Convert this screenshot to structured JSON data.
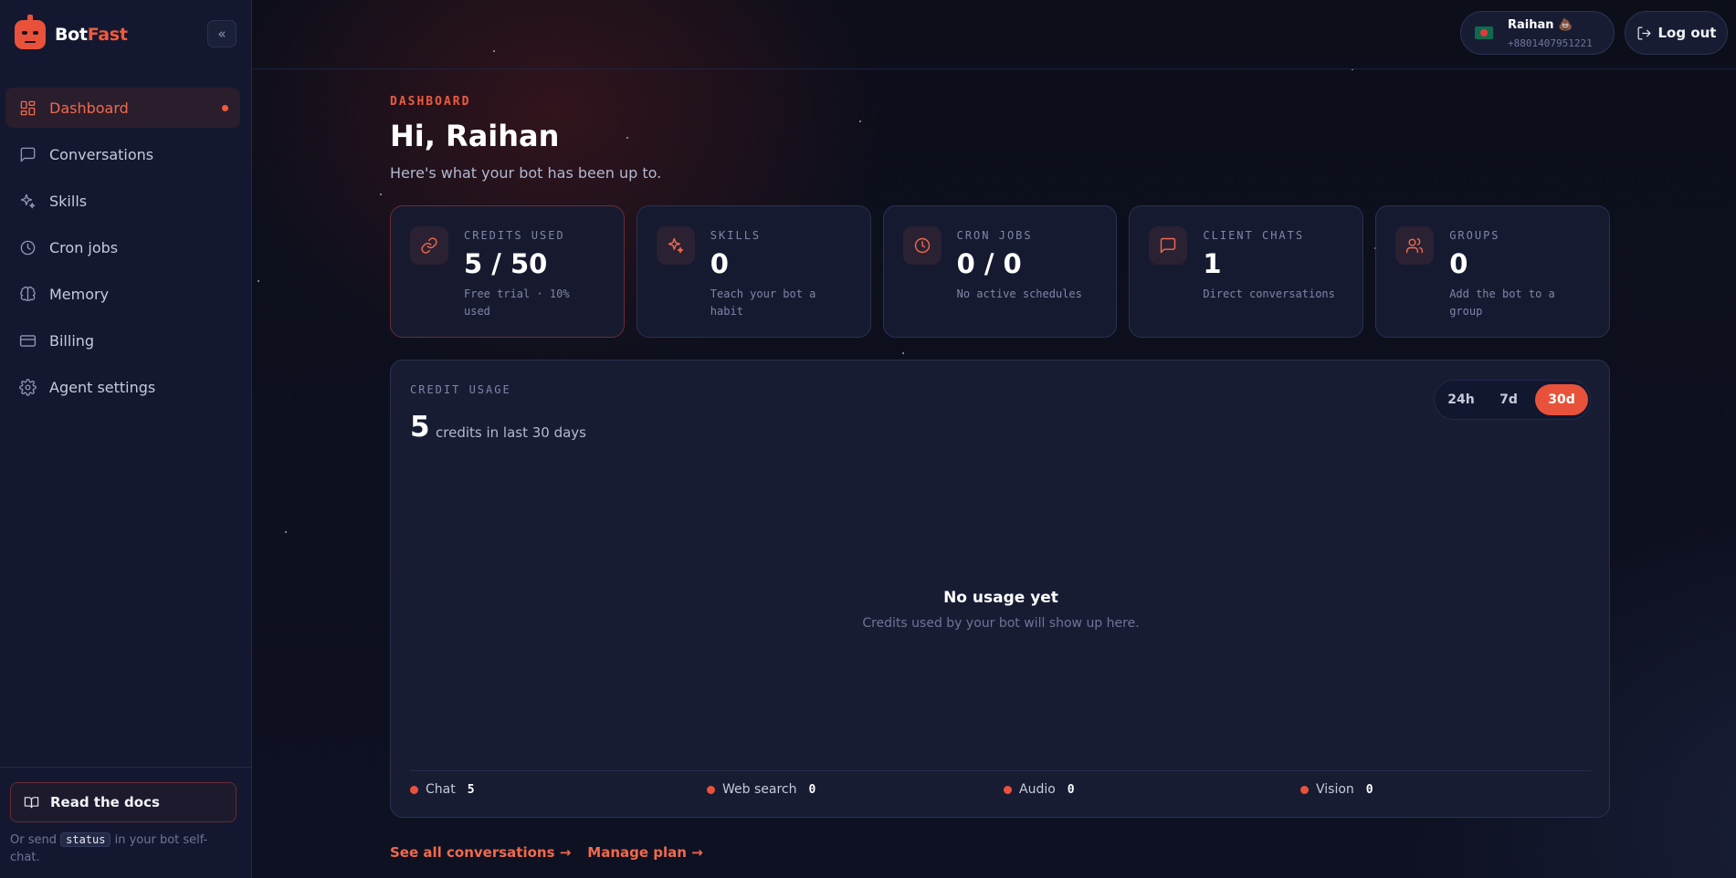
{
  "brand": {
    "name_a": "Bot",
    "name_b": "Fast"
  },
  "sidebar": {
    "items": [
      {
        "label": "Dashboard",
        "icon": "dashboard-icon"
      },
      {
        "label": "Conversations",
        "icon": "message-icon"
      },
      {
        "label": "Skills",
        "icon": "sparkle-icon"
      },
      {
        "label": "Cron jobs",
        "icon": "clock-icon"
      },
      {
        "label": "Memory",
        "icon": "brain-icon"
      },
      {
        "label": "Billing",
        "icon": "credit-card-icon"
      },
      {
        "label": "Agent settings",
        "icon": "gear-icon"
      }
    ],
    "docs_label": "Read the docs",
    "foot_pre": "Or send",
    "foot_code": "status",
    "foot_post": "in your bot self-chat."
  },
  "user": {
    "name": "Raihan 💩",
    "phone": "+8801407951221"
  },
  "logout_label": "Log out",
  "header": {
    "eyebrow": "DASHBOARD",
    "greeting": "Hi, Raihan",
    "subtitle": "Here's what your bot has been up to."
  },
  "stats": [
    {
      "label": "CREDITS USED",
      "value": "5 / 50",
      "desc": "Free trial · 10% used",
      "icon": "link-icon"
    },
    {
      "label": "SKILLS",
      "value": "0",
      "desc": "Teach your bot a habit",
      "icon": "sparkle-icon"
    },
    {
      "label": "CRON JOBS",
      "value": "0 / 0",
      "desc": "No active schedules",
      "icon": "clock-icon"
    },
    {
      "label": "CLIENT CHATS",
      "value": "1",
      "desc": "Direct conversations",
      "icon": "message-icon"
    },
    {
      "label": "GROUPS",
      "value": "0",
      "desc": "Add the bot to a group",
      "icon": "users-icon"
    }
  ],
  "usage": {
    "label": "CREDIT USAGE",
    "total": "5",
    "total_label": "credits in last 30 days",
    "ranges": [
      "24h",
      "7d",
      "30d"
    ],
    "selected_range": "30d",
    "empty_title": "No usage yet",
    "empty_sub": "Credits used by your bot will show up here.",
    "legend": [
      {
        "label": "Chat",
        "value": "5"
      },
      {
        "label": "Web search",
        "value": "0"
      },
      {
        "label": "Audio",
        "value": "0"
      },
      {
        "label": "Vision",
        "value": "0"
      }
    ]
  },
  "links": {
    "conversations": "See all conversations →",
    "plan": "Manage plan →"
  },
  "colors": {
    "accent": "#e9523a",
    "background": "#0d1020",
    "panel": "#171c33"
  }
}
